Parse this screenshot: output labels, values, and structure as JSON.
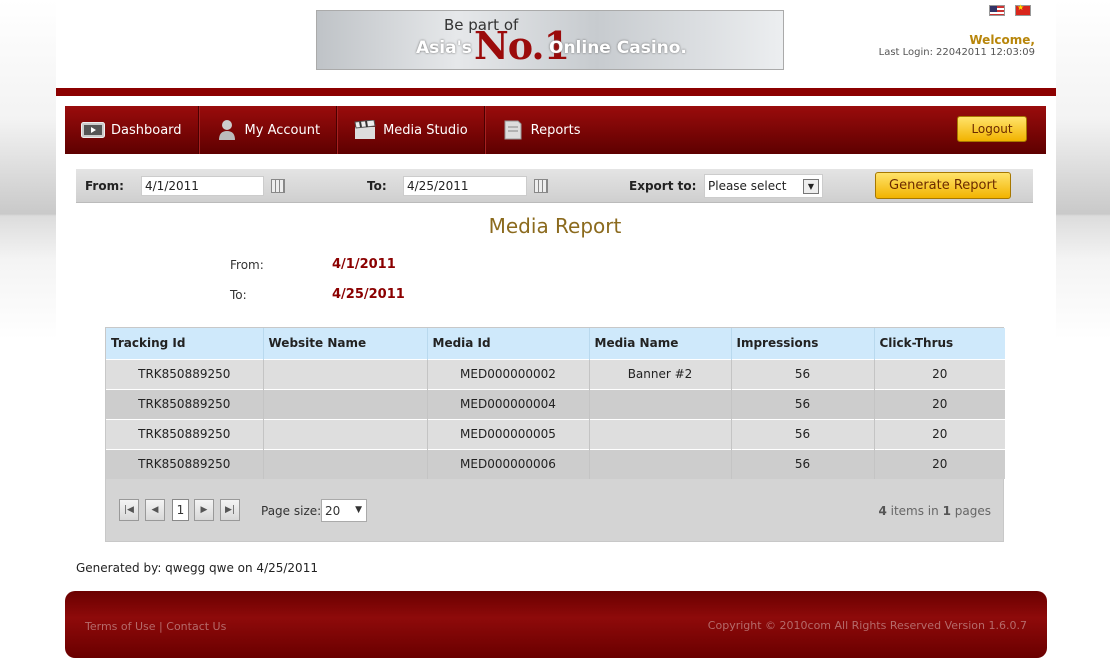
{
  "header": {
    "banner": {
      "line1": "Be part of",
      "line2": "Asia's",
      "big": "No.1",
      "line3": "Online Casino."
    },
    "welcome": "Welcome,",
    "last_login_label": "Last Login:",
    "last_login_value": "22042011 12:03:09",
    "flags": [
      "us-flag-icon",
      "china-flag-icon"
    ]
  },
  "nav": {
    "items": [
      {
        "label": "Dashboard",
        "icon": "dashboard-icon"
      },
      {
        "label": "My Account",
        "icon": "user-icon"
      },
      {
        "label": "Media Studio",
        "icon": "clapperboard-icon"
      },
      {
        "label": "Reports",
        "icon": "report-icon"
      }
    ],
    "logout": "Logout"
  },
  "filter": {
    "from_label": "From:",
    "from_value": "4/1/2011",
    "to_label": "To:",
    "to_value": "4/25/2011",
    "export_label": "Export to:",
    "export_selected": "Please select",
    "generate_label": "Generate Report"
  },
  "report": {
    "title": "Media Report",
    "from_label": "From:",
    "from_value": "4/1/2011",
    "to_label": "To:",
    "to_value": "4/25/2011"
  },
  "table": {
    "columns": [
      "Tracking Id",
      "Website Name",
      "Media Id",
      "Media Name",
      "Impressions",
      "Click-Thrus"
    ],
    "rows": [
      [
        "TRK850889250",
        "",
        "MED000000002",
        "Banner #2",
        "56",
        "20"
      ],
      [
        "TRK850889250",
        "",
        "MED000000004",
        "",
        "56",
        "20"
      ],
      [
        "TRK850889250",
        "",
        "MED000000005",
        "",
        "56",
        "20"
      ],
      [
        "TRK850889250",
        "",
        "MED000000006",
        "",
        "56",
        "20"
      ]
    ]
  },
  "pager": {
    "current_page": "1",
    "page_size_label": "Page size:",
    "page_size_value": "20",
    "items_count": "4",
    "items_text": "items in",
    "pages_count": "1",
    "pages_text": "pages"
  },
  "generated": "Generated by: qwegg qwe on 4/25/2011",
  "footer": {
    "terms": "Terms of Use",
    "separator": "|",
    "contact": "Contact Us",
    "copyright": "Copyright © 2010com All Rights Reserved",
    "version": "Version 1.6.0.7"
  },
  "colors": {
    "nav_red": "#8c0000",
    "gold_button": "#f2b300",
    "title_gold": "#8b6a1d",
    "value_red": "#8b0000",
    "header_blue": "#cfe9fb"
  }
}
